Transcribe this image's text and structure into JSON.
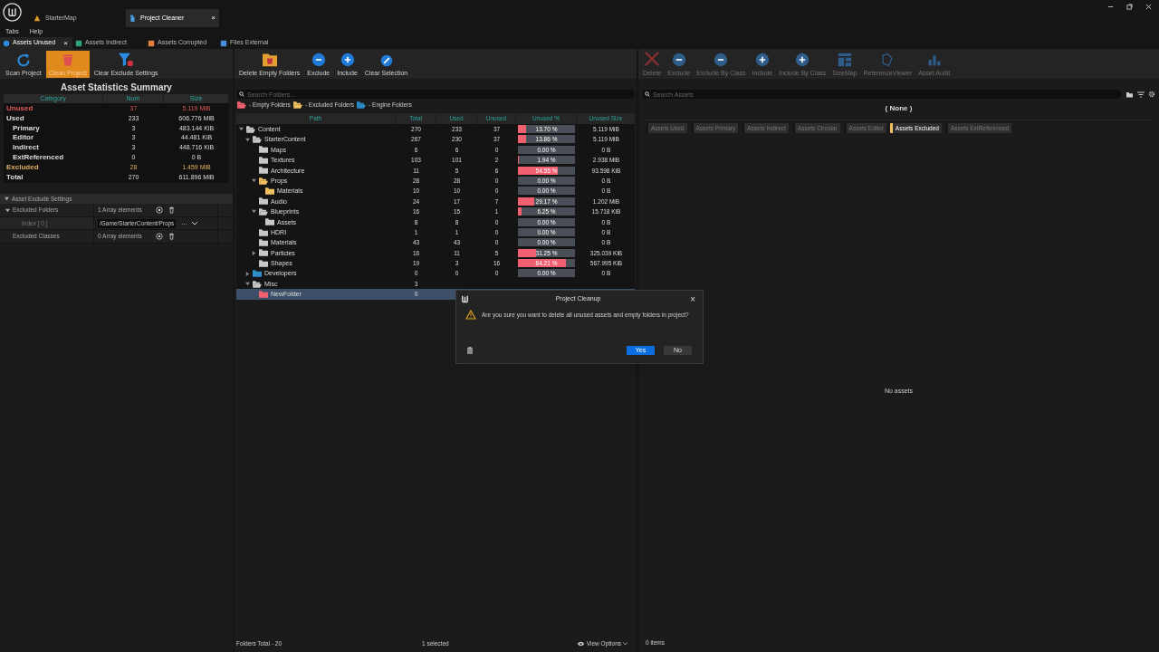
{
  "title_bar": {
    "doc_tabs": [
      {
        "label": "StarterMap",
        "selected": false,
        "kind": "map"
      },
      {
        "label": "Project Cleaner",
        "selected": true,
        "kind": "cleaner",
        "close": "×"
      }
    ]
  },
  "menu": [
    "Tabs",
    "Help"
  ],
  "tabs": [
    {
      "label": "Assets Unused",
      "selected": true,
      "close": "×",
      "kind": "unused"
    },
    {
      "label": "Assets Indirect",
      "selected": false,
      "kind": "indirect"
    },
    {
      "label": "Assets Corrupted",
      "selected": false,
      "kind": "corrupted"
    },
    {
      "label": "Files External",
      "selected": false,
      "kind": "external"
    }
  ],
  "left_toolbar": [
    {
      "label": "Scan Project",
      "kind": "scan",
      "active": false
    },
    {
      "label": "Clean Project",
      "kind": "clean",
      "active": true
    },
    {
      "label": "Clear Exclude Settings",
      "kind": "clear_exclude",
      "active": false
    }
  ],
  "statistics": {
    "title": "Asset Statistics Summary",
    "columns": [
      "Category",
      "Num",
      "Size"
    ],
    "rows": [
      {
        "category": "Unused",
        "num": "37",
        "size": "5.119 MiB",
        "kind": "unused"
      },
      {
        "category": "Used",
        "num": "233",
        "size": "606.776 MiB",
        "kind": "main"
      },
      {
        "category": "Primary",
        "num": "3",
        "size": "483.144 KiB",
        "kind": "sub"
      },
      {
        "category": "Editor",
        "num": "3",
        "size": "44.481 KiB",
        "kind": "sub"
      },
      {
        "category": "Indirect",
        "num": "3",
        "size": "448.716 KiB",
        "kind": "sub"
      },
      {
        "category": "ExtReferenced",
        "num": "0",
        "size": "0 B",
        "kind": "sub"
      },
      {
        "category": "Excluded",
        "num": "28",
        "size": "1.459 MiB",
        "kind": "excluded"
      },
      {
        "category": "Total",
        "num": "270",
        "size": "611.896 MiB",
        "kind": "main"
      }
    ]
  },
  "exclude_settings": {
    "title": "Asset Exclude Settings",
    "expanded": true,
    "rows": [
      {
        "label": "Excluded Folders",
        "value": "1 Array elements",
        "kind": "array",
        "expanded": true
      },
      {
        "label": "Index [ 0 ]",
        "value": "/Game/StarterContent/Props",
        "kind": "path",
        "browse": "..."
      },
      {
        "label": "Excluded Classes",
        "value": "0 Array elements",
        "kind": "array"
      }
    ]
  },
  "middle_toolbar": [
    {
      "label": "Delete Empty Folders",
      "kind": "delete_folders"
    },
    {
      "label": "Exclude",
      "kind": "minus"
    },
    {
      "label": "Include",
      "kind": "plus"
    },
    {
      "label": "Clear Selection",
      "kind": "clear"
    }
  ],
  "folder_search": {
    "placeholder": "Search Folders..."
  },
  "legend": [
    {
      "label": "- Empty Folders",
      "kind": "empty"
    },
    {
      "label": "- Excluded Folders",
      "kind": "excluded"
    },
    {
      "label": "- Engine Folders",
      "kind": "engine"
    }
  ],
  "folder_table": {
    "columns": [
      "Path",
      "Total",
      "Used",
      "Unused",
      "Unused %",
      "Unused Size"
    ],
    "rows": [
      {
        "name": "Content",
        "kind": "normal",
        "expanded": true,
        "selected": false,
        "total": "270",
        "used": "233",
        "unused": "37",
        "percent": "13.70 %",
        "level": 0.137,
        "size": "5.119 MiB",
        "children": [
          {
            "name": "StarterContent",
            "kind": "normal",
            "expanded": true,
            "selected": false,
            "total": "267",
            "used": "230",
            "unused": "37",
            "percent": "13.86 %",
            "level": 0.1386,
            "size": "5.119 MiB",
            "children": [
              {
                "name": "Maps",
                "kind": "normal",
                "selected": false,
                "total": "6",
                "used": "6",
                "unused": "0",
                "percent": "0.00 %",
                "level": 0,
                "size": "0 B"
              },
              {
                "name": "Textures",
                "kind": "normal",
                "selected": false,
                "total": "103",
                "used": "101",
                "unused": "2",
                "percent": "1.94 %",
                "level": 0.0194,
                "size": "2.938 MiB"
              },
              {
                "name": "Architecture",
                "kind": "normal",
                "selected": false,
                "total": "11",
                "used": "5",
                "unused": "6",
                "percent": "54.55 %",
                "level": 0.5455,
                "size": "93.598 KiB"
              },
              {
                "name": "Props",
                "kind": "excluded",
                "expanded": true,
                "selected": false,
                "total": "28",
                "used": "28",
                "unused": "0",
                "percent": "0.00 %",
                "level": 0,
                "size": "0 B",
                "children": [
                  {
                    "name": "Materials",
                    "kind": "excluded",
                    "selected": false,
                    "total": "10",
                    "used": "10",
                    "unused": "0",
                    "percent": "0.00 %",
                    "level": 0,
                    "size": "0 B"
                  }
                ]
              },
              {
                "name": "Audio",
                "kind": "normal",
                "selected": false,
                "total": "24",
                "used": "17",
                "unused": "7",
                "percent": "29.17 %",
                "level": 0.2917,
                "size": "1.202 MiB"
              },
              {
                "name": "Blueprints",
                "kind": "normal",
                "expanded": true,
                "selected": false,
                "total": "16",
                "used": "15",
                "unused": "1",
                "percent": "6.25 %",
                "level": 0.0625,
                "size": "15.718 KiB",
                "children": [
                  {
                    "name": "Assets",
                    "kind": "normal",
                    "selected": false,
                    "total": "8",
                    "used": "8",
                    "unused": "0",
                    "percent": "0.00 %",
                    "level": 0,
                    "size": "0 B"
                  }
                ]
              },
              {
                "name": "HDRI",
                "kind": "normal",
                "selected": false,
                "total": "1",
                "used": "1",
                "unused": "0",
                "percent": "0.00 %",
                "level": 0,
                "size": "0 B"
              },
              {
                "name": "Materials",
                "kind": "normal",
                "selected": false,
                "total": "43",
                "used": "43",
                "unused": "0",
                "percent": "0.00 %",
                "level": 0,
                "size": "0 B"
              },
              {
                "name": "Particles",
                "kind": "normal",
                "expanded": false,
                "selected": false,
                "total": "16",
                "used": "11",
                "unused": "5",
                "percent": "31.25 %",
                "level": 0.3125,
                "size": "325.039 KiB"
              },
              {
                "name": "Shapes",
                "kind": "normal",
                "selected": false,
                "total": "19",
                "used": "3",
                "unused": "16",
                "percent": "84.21 %",
                "level": 0.8421,
                "size": "567.995 KiB"
              }
            ]
          },
          {
            "name": "Developers",
            "kind": "engine",
            "expanded": false,
            "selected": false,
            "total": "0",
            "used": "0",
            "unused": "0",
            "percent": "0.00 %",
            "level": 0,
            "size": "0 B"
          },
          {
            "name": "Misc",
            "kind": "normal",
            "expanded": true,
            "selected": false,
            "total": "3",
            "children": [
              {
                "name": "NewFolder",
                "kind": "empty",
                "selected": true,
                "total": "0"
              }
            ]
          }
        ]
      }
    ]
  },
  "folder_status": {
    "count": "Folders Total - 20",
    "selection": "1 selected",
    "view_options": "View Options"
  },
  "right_toolbar": [
    {
      "label": "Delete",
      "kind": "delete"
    },
    {
      "label": "Exclude",
      "kind": "minus"
    },
    {
      "label": "Exclude By Class",
      "kind": "minus"
    },
    {
      "label": "Include",
      "kind": "plus"
    },
    {
      "label": "Include By Class",
      "kind": "plus"
    },
    {
      "label": "SizeMap",
      "kind": "sizemap"
    },
    {
      "label": "ReferenceViewer",
      "kind": "refviewer"
    },
    {
      "label": "Asset Audit",
      "kind": "audit"
    }
  ],
  "asset_search": {
    "placeholder": "Search Assets"
  },
  "path_label": "( None )",
  "filters": [
    {
      "label": "Assets Used",
      "selected": false
    },
    {
      "label": "Assets Primary",
      "selected": false
    },
    {
      "label": "Assets Indirect",
      "selected": false
    },
    {
      "label": "Assets Circular",
      "selected": false
    },
    {
      "label": "Assets Editor",
      "selected": false
    },
    {
      "label": "Assets Excluded",
      "selected": true
    },
    {
      "label": "Assets ExtReferenced",
      "selected": false
    }
  ],
  "empty_message": "No assets",
  "asset_status": "0 items",
  "dialog": {
    "title": "Project Cleanup",
    "close": "×",
    "message": "Are you sure you want to delete all unused assets and empty folders in project?",
    "buttons": [
      {
        "label": "Yes",
        "kind": "primary"
      },
      {
        "label": "No",
        "kind": "secondary"
      }
    ]
  }
}
